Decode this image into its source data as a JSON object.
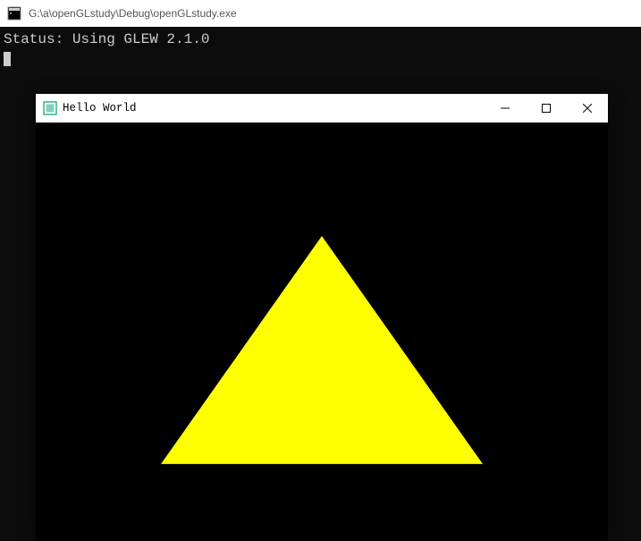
{
  "console": {
    "title": "G:\\a\\openGLstudy\\Debug\\openGLstudy.exe",
    "status_line": "Status: Using GLEW 2.1.0"
  },
  "app": {
    "title": "Hello World",
    "triangle_color": "#ffff00",
    "background_color": "#000000"
  }
}
